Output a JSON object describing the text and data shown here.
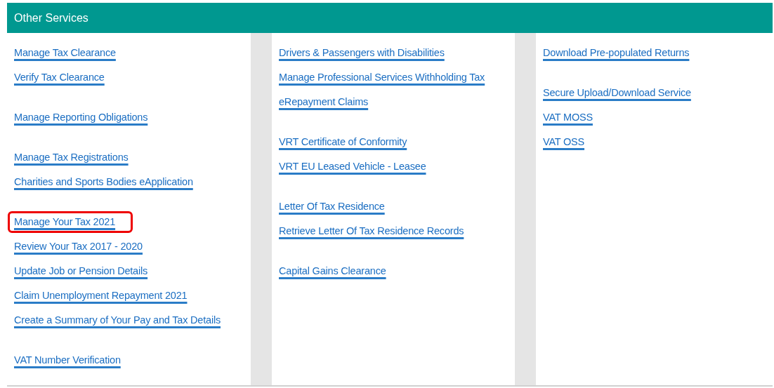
{
  "panel": {
    "title": "Other Services"
  },
  "columns": [
    {
      "groups": [
        {
          "links": [
            {
              "label": "Manage Tax Clearance",
              "highlighted": false
            },
            {
              "label": "Verify Tax Clearance",
              "highlighted": false
            }
          ]
        },
        {
          "links": [
            {
              "label": "Manage Reporting Obligations",
              "highlighted": false
            }
          ]
        },
        {
          "links": [
            {
              "label": "Manage Tax Registrations",
              "highlighted": false
            },
            {
              "label": "Charities and Sports Bodies eApplication",
              "highlighted": false
            }
          ]
        },
        {
          "links": [
            {
              "label": "Manage Your Tax 2021",
              "highlighted": true
            },
            {
              "label": "Review Your Tax 2017 - 2020",
              "highlighted": false
            },
            {
              "label": "Update Job or Pension Details",
              "highlighted": false
            },
            {
              "label": "Claim Unemployment Repayment 2021",
              "highlighted": false
            },
            {
              "label": "Create a Summary of Your Pay and Tax Details",
              "highlighted": false
            }
          ]
        },
        {
          "links": [
            {
              "label": "VAT Number Verification",
              "highlighted": false
            }
          ]
        }
      ]
    },
    {
      "groups": [
        {
          "links": [
            {
              "label": "Drivers & Passengers with Disabilities",
              "highlighted": false
            },
            {
              "label": "Manage Professional Services Withholding Tax",
              "highlighted": false
            },
            {
              "label": "eRepayment Claims",
              "highlighted": false
            }
          ]
        },
        {
          "links": [
            {
              "label": "VRT Certificate of Conformity",
              "highlighted": false
            },
            {
              "label": "VRT EU Leased Vehicle - Leasee",
              "highlighted": false
            }
          ]
        },
        {
          "links": [
            {
              "label": "Letter Of Tax Residence",
              "highlighted": false
            },
            {
              "label": "Retrieve Letter Of Tax Residence Records",
              "highlighted": false
            }
          ]
        },
        {
          "links": [
            {
              "label": "Capital Gains Clearance",
              "highlighted": false
            }
          ]
        }
      ]
    },
    {
      "groups": [
        {
          "links": [
            {
              "label": "Download Pre-populated Returns",
              "highlighted": false
            }
          ]
        },
        {
          "links": [
            {
              "label": "Secure Upload/Download Service",
              "highlighted": false
            },
            {
              "label": "VAT MOSS",
              "highlighted": false
            },
            {
              "label": "VAT OSS",
              "highlighted": false
            }
          ]
        }
      ]
    }
  ]
}
